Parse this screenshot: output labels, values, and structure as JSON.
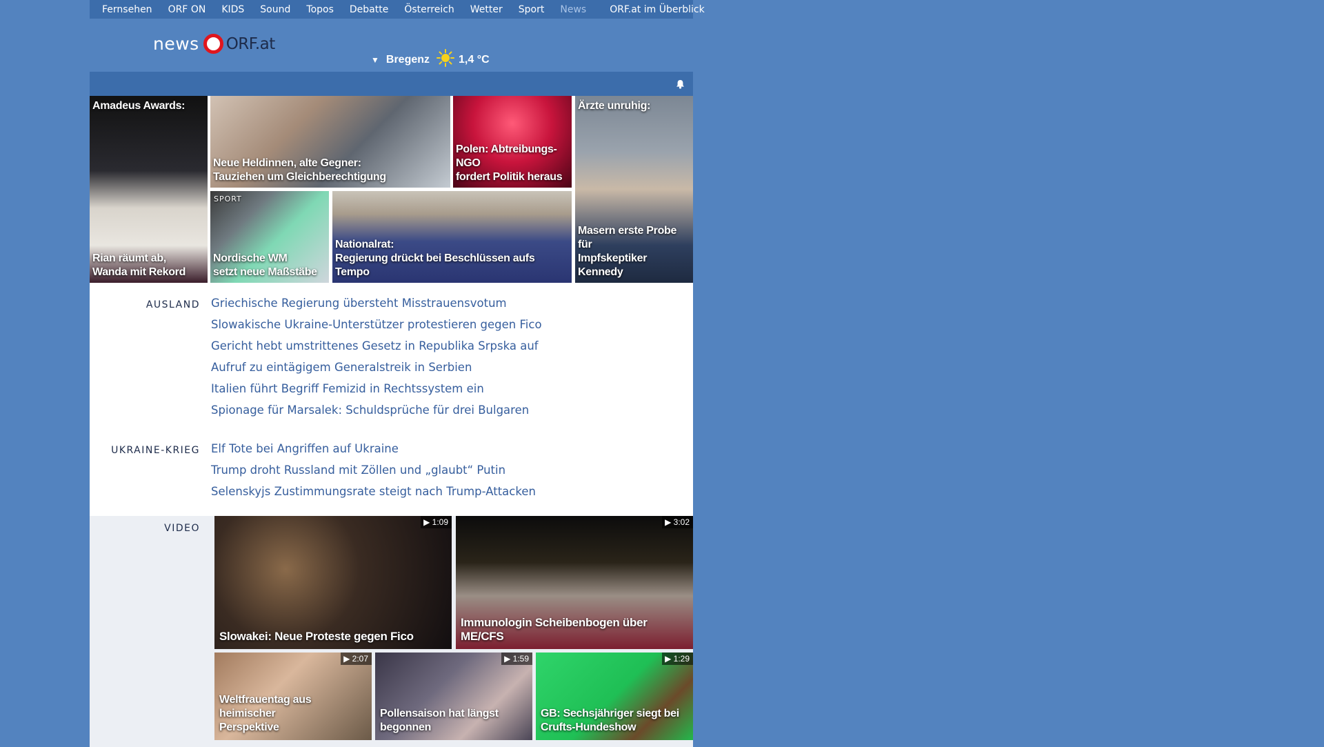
{
  "nav": {
    "items": [
      "Fernsehen",
      "ORF ON",
      "KIDS",
      "Sound",
      "Topos",
      "Debatte",
      "Österreich",
      "Wetter",
      "Sport",
      "News"
    ],
    "active": "News",
    "overview": "ORF.at im Überblick"
  },
  "logo": {
    "word1": "news",
    "word2": "ORF.at"
  },
  "weather": {
    "city": "Bregenz",
    "temperature": "1,4 °C",
    "icon": "sun-icon"
  },
  "mosaic": {
    "t1": {
      "top": "Amadeus Awards:",
      "title_l1": "Rian räumt ab,",
      "title_l2": "Wanda mit Rekord"
    },
    "t2": {
      "title_l1": "Neue Heldinnen, alte Gegner:",
      "title_l2": "Tauziehen um Gleichberechtigung"
    },
    "t3": {
      "title_l1": "Polen: Abtreibungs-NGO",
      "title_l2": "fordert Politik heraus"
    },
    "t4": {
      "top": "Ärzte unruhig:",
      "title_l1": "Masern erste Probe für",
      "title_l2": "Impfskeptiker Kennedy"
    },
    "t5": {
      "kicker": "SPORT",
      "title_l1": "Nordische WM",
      "title_l2": "setzt neue Maßstäbe"
    },
    "t6": {
      "title_l1": "Nationalrat:",
      "title_l2": "Regierung drückt bei Beschlüssen aufs Tempo"
    }
  },
  "sections": [
    {
      "label": "AUSLAND",
      "items": [
        "Griechische Regierung übersteht Misstrauensvotum",
        "Slowakische Ukraine-Unterstützer protestieren gegen Fico",
        "Gericht hebt umstrittenes Gesetz in Republika Srpska auf",
        "Aufruf zu eintägigem Generalstreik in Serbien",
        "Italien führt Begriff Femizid in Rechtssystem ein",
        "Spionage für Marsalek: Schuldsprüche für drei Bulgaren"
      ]
    },
    {
      "label": "UKRAINE-KRIEG",
      "items": [
        "Elf Tote bei Angriffen auf Ukraine",
        "Trump droht Russland mit Zöllen und „glaubt“ Putin",
        "Selenskyjs Zustimmungsrate steigt nach Trump-Attacken"
      ]
    }
  ],
  "video": {
    "label": "VIDEO",
    "items": [
      {
        "duration": "1:09",
        "title_l1": "Slowakei: Neue Proteste gegen Fico",
        "title_l2": ""
      },
      {
        "duration": "3:02",
        "title_l1": "Immunologin Scheibenbogen über ME/CFS",
        "title_l2": ""
      },
      {
        "duration": "2:07",
        "title_l1": "Weltfrauentag aus heimischer",
        "title_l2": "Perspektive"
      },
      {
        "duration": "1:59",
        "title_l1": "Pollensaison hat längst",
        "title_l2": "begonnen"
      },
      {
        "duration": "1:29",
        "title_l1": "GB: Sechsjähriger siegt bei",
        "title_l2": "Crufts-Hundeshow"
      }
    ]
  },
  "colors": {
    "background": "#5383bf",
    "nav_bar": "#3c6dab",
    "link": "#365e9d",
    "orf_red": "#e0161d"
  }
}
